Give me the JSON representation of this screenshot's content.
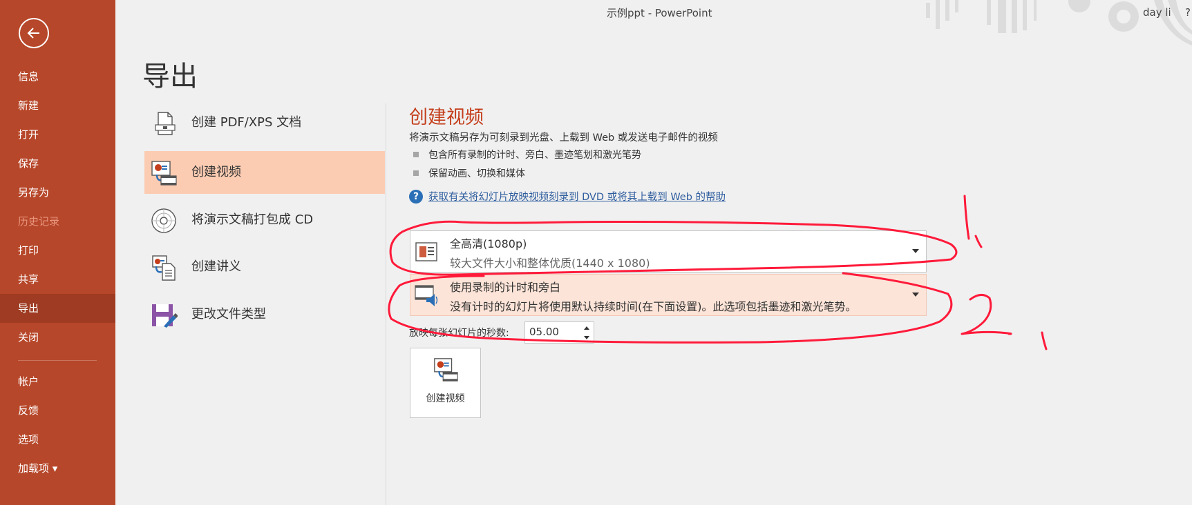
{
  "window": {
    "title": "示例ppt  -  PowerPoint",
    "user": "day li",
    "help": "?"
  },
  "sidebar": {
    "items": [
      {
        "label": "信息",
        "state": "normal"
      },
      {
        "label": "新建",
        "state": "normal"
      },
      {
        "label": "打开",
        "state": "normal"
      },
      {
        "label": "保存",
        "state": "normal"
      },
      {
        "label": "另存为",
        "state": "normal"
      },
      {
        "label": "历史记录",
        "state": "disabled"
      },
      {
        "label": "打印",
        "state": "normal"
      },
      {
        "label": "共享",
        "state": "normal"
      },
      {
        "label": "导出",
        "state": "active"
      },
      {
        "label": "关闭",
        "state": "normal"
      },
      {
        "label": "帐户",
        "state": "normal"
      },
      {
        "label": "反馈",
        "state": "normal"
      },
      {
        "label": "选项",
        "state": "normal"
      },
      {
        "label": "加载项 ▾",
        "state": "normal"
      }
    ]
  },
  "page": {
    "title": "导出"
  },
  "export_options": [
    {
      "label": "创建 PDF/XPS 文档",
      "icon": "pdf-document-icon"
    },
    {
      "label": "创建视频",
      "icon": "video-icon",
      "selected": true
    },
    {
      "label": "将演示文稿打包成 CD",
      "icon": "cd-icon"
    },
    {
      "label": "创建讲义",
      "icon": "handout-icon"
    },
    {
      "label": "更改文件类型",
      "icon": "file-type-icon"
    }
  ],
  "detail": {
    "title": "创建视频",
    "description": "将演示文稿另存为可刻录到光盘、上载到 Web 或发送电子邮件的视频",
    "bullets": [
      "包含所有录制的计时、旁白、墨迹笔划和激光笔势",
      "保留动画、切换和媒体"
    ],
    "help_link": "获取有关将幻灯片放映视频刻录到 DVD 或将其上载到 Web 的帮助",
    "quality": {
      "title": "全高清(1080p)",
      "subtitle": "较大文件大小和整体优质(1440 x 1080)"
    },
    "timing": {
      "title": "使用录制的计时和旁白",
      "subtitle": "没有计时的幻灯片将使用默认持续时间(在下面设置)。此选项包括墨迹和激光笔势。"
    },
    "seconds_label": "放映每张幻灯片的秒数:",
    "seconds_value": "05.00",
    "create_button_label": "创建视频"
  },
  "annotations": [
    "1、",
    "2、"
  ],
  "colors": {
    "sidebar": "#b7472a",
    "sidebar_active": "#9e3b22",
    "selected_option": "#fcccb2",
    "accent_title": "#c43e1c",
    "annotation": "#ff1a3a"
  }
}
